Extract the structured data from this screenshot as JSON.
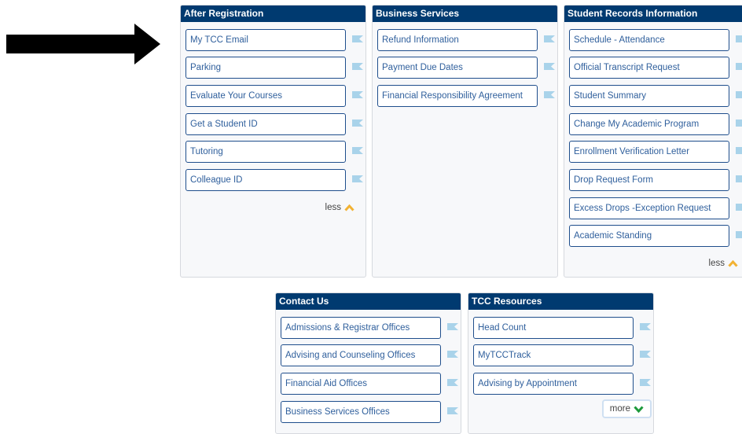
{
  "colors": {
    "header_bg": "#003a70",
    "link_text": "#2f5f9c",
    "flag": "#a9d3ea",
    "chevron_up": "#f2b233",
    "chevron_down": "#1e9a3c"
  },
  "cards": {
    "after_registration": {
      "title": "After Registration",
      "items": [
        "My TCC Email",
        "Parking",
        "Evaluate Your Courses",
        "Get a Student ID",
        "Tutoring",
        "Colleague ID"
      ],
      "toggle": "less"
    },
    "business_services": {
      "title": "Business Services",
      "items": [
        "Refund Information",
        "Payment Due Dates",
        "Financial Responsibility Agreement"
      ]
    },
    "student_records": {
      "title": "Student Records Information",
      "items": [
        "Schedule - Attendance",
        "Official Transcript Request",
        "Student Summary",
        "Change My Academic Program",
        "Enrollment Verification Letter",
        "Drop Request Form",
        "Excess Drops -Exception Request",
        "Academic Standing"
      ],
      "toggle": "less"
    },
    "contact_us": {
      "title": "Contact Us",
      "items": [
        "Admissions & Registrar Offices",
        "Advising and Counseling Offices",
        "Financial Aid Offices",
        "Business Services Offices"
      ]
    },
    "tcc_resources": {
      "title": "TCC Resources",
      "items": [
        "Head Count",
        "MyTCCTrack",
        "Advising by Appointment"
      ],
      "toggle": "more"
    }
  }
}
